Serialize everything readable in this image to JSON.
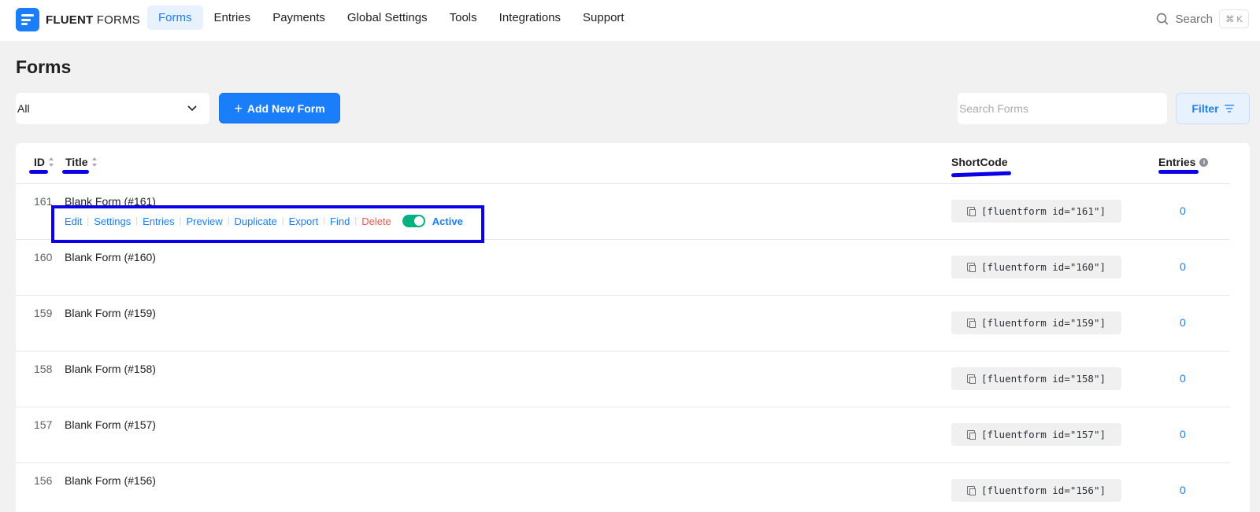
{
  "brand": {
    "bold": "FLUENT",
    "light": " FORMS"
  },
  "nav": [
    {
      "label": "Forms",
      "active": true
    },
    {
      "label": "Entries",
      "active": false
    },
    {
      "label": "Payments",
      "active": false
    },
    {
      "label": "Global Settings",
      "active": false
    },
    {
      "label": "Tools",
      "active": false
    },
    {
      "label": "Integrations",
      "active": false
    },
    {
      "label": "Support",
      "active": false
    }
  ],
  "top_search": {
    "label": "Search",
    "shortcut": "⌘ K"
  },
  "page_title": "Forms",
  "toolbar": {
    "filter_select_value": "All",
    "add_button_label": "Add New Form",
    "search_placeholder": "Search Forms",
    "filter_button_label": "Filter"
  },
  "table": {
    "headers": {
      "id": "ID",
      "title": "Title",
      "shortcode": "ShortCode",
      "entries": "Entries"
    },
    "row_actions": [
      "Edit",
      "Settings",
      "Entries",
      "Preview",
      "Duplicate",
      "Export",
      "Find",
      "Delete"
    ],
    "status_label": "Active",
    "rows": [
      {
        "id": "161",
        "title": "Blank Form (#161)",
        "shortcode": "[fluentform id=\"161\"]",
        "entries": "0"
      },
      {
        "id": "160",
        "title": "Blank Form (#160)",
        "shortcode": "[fluentform id=\"160\"]",
        "entries": "0"
      },
      {
        "id": "159",
        "title": "Blank Form (#159)",
        "shortcode": "[fluentform id=\"159\"]",
        "entries": "0"
      },
      {
        "id": "158",
        "title": "Blank Form (#158)",
        "shortcode": "[fluentform id=\"158\"]",
        "entries": "0"
      },
      {
        "id": "157",
        "title": "Blank Form (#157)",
        "shortcode": "[fluentform id=\"157\"]",
        "entries": "0"
      },
      {
        "id": "156",
        "title": "Blank Form (#156)",
        "shortcode": "[fluentform id=\"156\"]",
        "entries": "0"
      }
    ]
  },
  "colors": {
    "accent": "#1a7efb",
    "annotation": "#0b00e6",
    "toggle_on": "#00b27f",
    "danger": "#f0554b"
  }
}
